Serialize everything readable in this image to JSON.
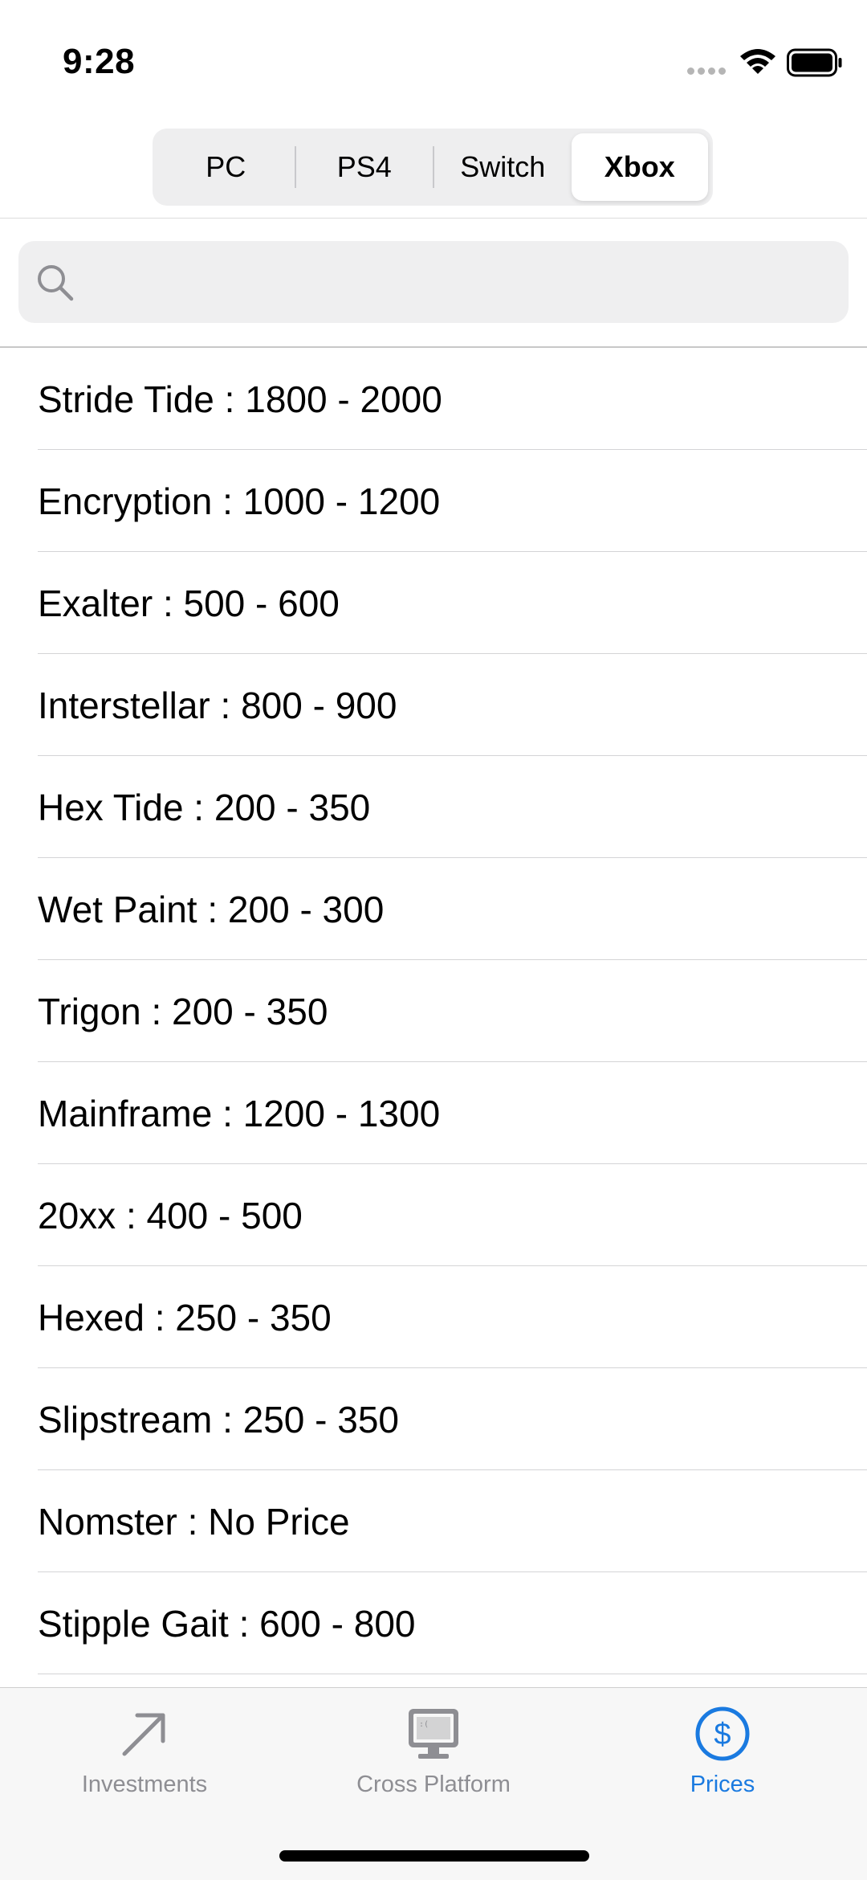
{
  "status_bar": {
    "time": "9:28"
  },
  "platform_selector": {
    "segments": [
      {
        "label": "PC",
        "selected": false
      },
      {
        "label": "PS4",
        "selected": false
      },
      {
        "label": "Switch",
        "selected": false
      },
      {
        "label": "Xbox",
        "selected": true
      }
    ]
  },
  "search": {
    "placeholder": "",
    "icon": "search-icon"
  },
  "price_list": {
    "items": [
      "Stride Tide : 1800 - 2000",
      "Encryption : 1000 - 1200",
      "Exalter : 500 - 600",
      "Interstellar : 800 - 900",
      "Hex Tide : 200 - 350",
      "Wet Paint : 200 - 300",
      "Trigon : 200 - 350",
      "Mainframe : 1200 - 1300",
      "20xx : 400 - 500",
      "Hexed : 250 - 350",
      "Slipstream : 250 - 350",
      "Nomster : No Price",
      "Stipple Gait : 600 - 800"
    ]
  },
  "tab_bar": {
    "tabs": [
      {
        "label": "Investments",
        "icon": "arrow-up-right-icon",
        "active": false
      },
      {
        "label": "Cross Platform",
        "icon": "desktop-computer-icon",
        "active": false
      },
      {
        "label": "Prices",
        "icon": "dollar-circle-icon",
        "active": true
      }
    ]
  },
  "colors": {
    "accent": "#1a7ae0",
    "inactive_tab": "#8e8e93",
    "segment_bg": "#eeeeef",
    "search_bg": "#efeff0"
  }
}
